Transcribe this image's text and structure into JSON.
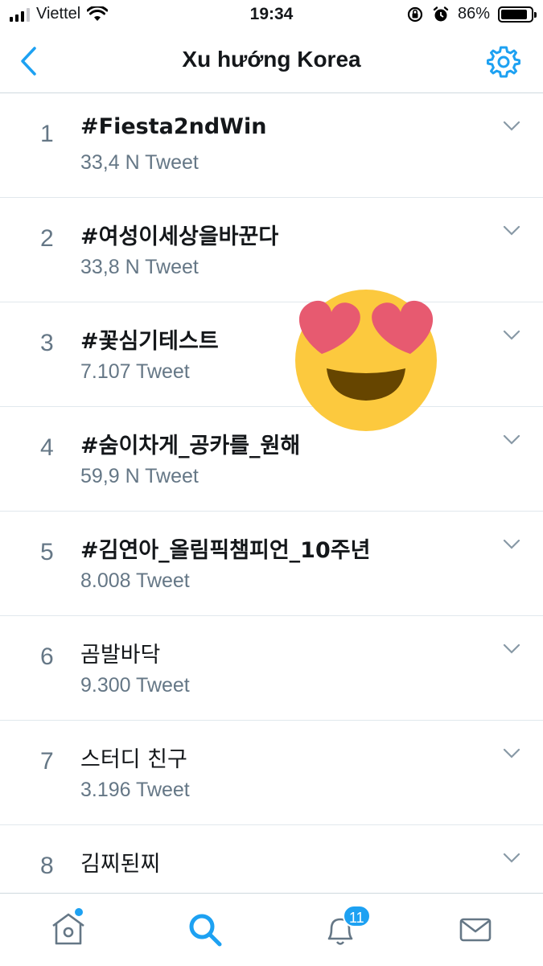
{
  "status_bar": {
    "carrier": "Viettel",
    "time": "19:34",
    "battery_percent": "86%",
    "battery_level": 0.86,
    "icons": [
      "signal-icon",
      "wifi-icon",
      "orientation-lock-icon",
      "alarm-icon",
      "battery-icon"
    ]
  },
  "nav": {
    "title": "Xu hướng Korea",
    "back_icon": "chevron-left-icon",
    "settings_icon": "gear-icon"
  },
  "trends": [
    {
      "rank": "1",
      "name": "#Fiesta2ndWin",
      "count": "33,4 N Tweet"
    },
    {
      "rank": "2",
      "name": "#여성이세상을바꾼다",
      "count": "33,8 N Tweet"
    },
    {
      "rank": "3",
      "name": "#꽃심기테스트",
      "count": "7.107 Tweet"
    },
    {
      "rank": "4",
      "name": "#숨이차게_공카를_원해",
      "count": "59,9 N Tweet"
    },
    {
      "rank": "5",
      "name": "#김연아_올림픽챔피언_10주년",
      "count": "8.008 Tweet"
    },
    {
      "rank": "6",
      "name": "곰발바닥",
      "count": "9.300 Tweet"
    },
    {
      "rank": "7",
      "name": "스터디 친구",
      "count": "3.196 Tweet"
    },
    {
      "rank": "8",
      "name": "김찌된찌",
      "count": ""
    }
  ],
  "tab_bar": {
    "tabs": [
      "home-icon",
      "search-icon",
      "notifications-icon",
      "messages-icon"
    ],
    "notifications_badge": "11",
    "accent_color": "#1da1f2"
  },
  "colors": {
    "accent": "#1da1f2",
    "secondary_text": "#657786",
    "primary_text": "#14171a",
    "divider": "#e1e8ed"
  }
}
